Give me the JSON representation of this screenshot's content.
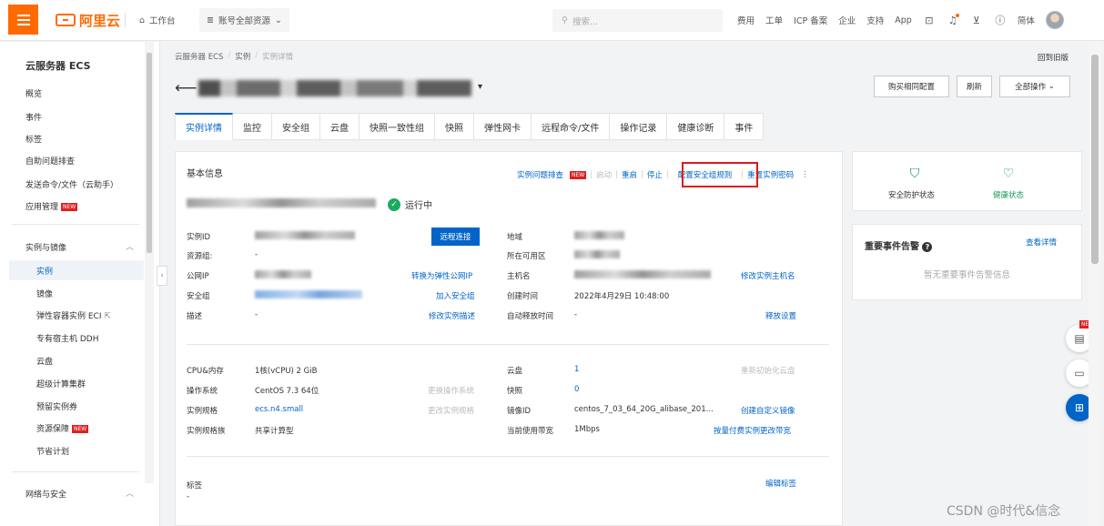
{
  "topbar": {
    "logo": "阿里云",
    "workbench": "工作台",
    "account_resources": "账号全部资源",
    "search_placeholder": "搜索...",
    "items": [
      "费用",
      "工单",
      "ICP 备案",
      "企业",
      "支持",
      "App"
    ],
    "lang": "简体"
  },
  "sidebar": {
    "title": "云服务器 ECS",
    "items": [
      "概览",
      "事件",
      "标签",
      "自助问题排查",
      "发送命令/文件（云助手）"
    ],
    "app_mgmt": "应用管理",
    "new_tag": "NEW",
    "group1": "实例与镜像",
    "group1_items": [
      "实例",
      "镜像",
      "弹性容器实例 ECI",
      "专有宿主机 DDH",
      "云盘",
      "超级计算集群",
      "预留实例券"
    ],
    "resource_guarantee": "资源保障",
    "saving_plan": "节省计划",
    "group2": "网络与安全"
  },
  "breadcrumb": {
    "items": [
      "云服务器 ECS",
      "实例"
    ],
    "current": "实例详情",
    "sep": "/"
  },
  "back_old": "回到旧版",
  "header_buttons": {
    "buy_same": "购买相同配置",
    "refresh": "刷新",
    "all_ops": "全部操作"
  },
  "tabs": [
    "实例详情",
    "监控",
    "安全组",
    "云盘",
    "快照一致性组",
    "快照",
    "弹性网卡",
    "远程命令/文件",
    "操作记录",
    "健康诊断",
    "事件"
  ],
  "basic": {
    "title": "基本信息",
    "ops": {
      "troubleshoot": "实例问题排查",
      "start": "启动",
      "restart": "重启",
      "stop": "停止",
      "config_sg": "配置安全组规则",
      "reset_pwd": "重置实例密码"
    },
    "status": "运行中",
    "remote_connect": "远程连接",
    "labels_left": [
      "实例ID",
      "资源组:",
      "公网IP",
      "安全组",
      "描述"
    ],
    "resource_group_val": "-",
    "desc_val": "-",
    "links_left": {
      "convert_eip": "转换为弹性公网IP",
      "join_sg": "加入安全组",
      "edit_desc": "修改实例描述"
    },
    "labels_right": [
      "地域",
      "所在可用区",
      "主机名",
      "创建时间",
      "自动释放时间"
    ],
    "created": "2022年4月29日 10:48:00",
    "auto_release": "-",
    "links_right": {
      "edit_hostname": "修改实例主机名",
      "release": "释放设置"
    }
  },
  "config": {
    "labels_left": [
      "CPU&内存",
      "操作系统",
      "实例规格",
      "实例规格族"
    ],
    "values_left": [
      "1核(vCPU) 2 GiB",
      "CentOS 7.3 64位",
      "ecs.n4.small",
      "共享计算型"
    ],
    "dis_left": [
      "更换操作系统",
      "更改实例规格"
    ],
    "labels_right": [
      "云盘",
      "快照",
      "镜像ID",
      "当前使用带宽"
    ],
    "values_right": [
      "1",
      "0",
      "centos_7_03_64_20G_alibase_201...",
      "1Mbps"
    ],
    "dis_right": "重新初始化云盘",
    "links_right": {
      "create_image": "创建自定义镜像",
      "bandwidth": "按量付费实例更改带宽"
    }
  },
  "tags_section": {
    "title": "标签",
    "val": "-",
    "edit": "编辑标签"
  },
  "status_card": {
    "security": "安全防护状态",
    "health": "健康状态"
  },
  "events_card": {
    "title": "重要事件告警",
    "view": "查看详情",
    "empty": "暂无重要事件告警信息"
  },
  "float_new": "NEW",
  "watermark": "CSDN @时代&信念"
}
